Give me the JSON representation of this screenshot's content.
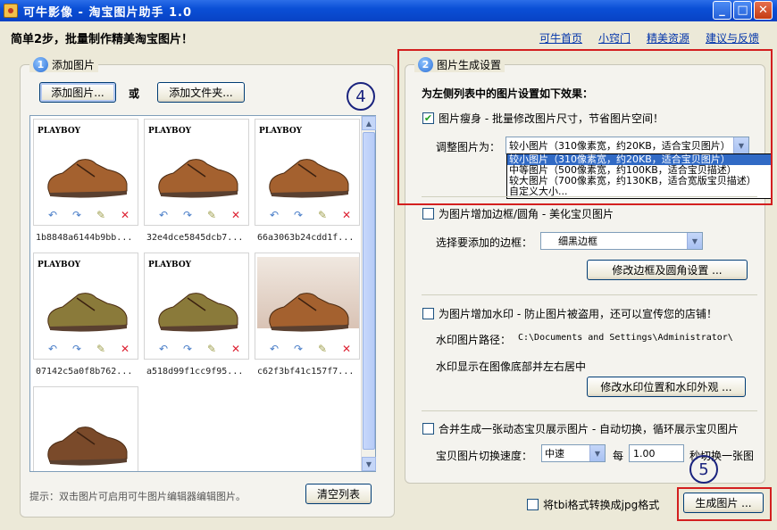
{
  "window": {
    "title": "可牛影像 - 淘宝图片助手 1.0",
    "min": "_",
    "max": "□",
    "close": "✕"
  },
  "heading": "简单2步，批量制作精美淘宝图片！",
  "links": [
    "可牛首页",
    "小窍门",
    "精美资源",
    "建议与反馈"
  ],
  "left": {
    "step_num": "1",
    "title": "添加图片",
    "add_image_btn": "添加图片...",
    "or": "或",
    "add_folder_btn": "添加文件夹...",
    "hint": "提示：双击图片可启用可牛图片编辑器编辑图片。",
    "clear_btn": "清空列表",
    "thumbs": [
      {
        "logo": "PLAYBOY",
        "name": "1b8848a6144b9bb..."
      },
      {
        "logo": "PLAYBOY",
        "name": "32e4dce5845dcb7..."
      },
      {
        "logo": "PLAYBOY",
        "name": "66a3063b24cdd1f..."
      },
      {
        "logo": "PLAYBOY",
        "name": "07142c5a0f8b762..."
      },
      {
        "logo": "PLAYBOY",
        "name": "a518d99f1cc9f95..."
      },
      {
        "logo": "",
        "name": "c62f3bf41c157f7..."
      },
      {
        "logo": "",
        "name": ""
      }
    ],
    "tool_icons": [
      "undo-icon",
      "redo-icon",
      "edit-icon",
      "delete-icon"
    ]
  },
  "right": {
    "step_num": "2",
    "title": "图片生成设置",
    "subtitle": "为左侧列表中的图片设置如下效果：",
    "resize": {
      "checked": true,
      "label": "图片瘦身 - 批量修改图片尺寸，节省图片空间！",
      "adjust_label": "调整图片为：",
      "selected": "较小图片（310像素宽，约20KB，适合宝贝图片）",
      "options": [
        "较小图片（310像素宽，约20KB，适合宝贝图片）",
        "中等图片（500像素宽，约100KB，适合宝贝描述）",
        "较大图片（700像素宽，约130KB，适合宽版宝贝描述）",
        "自定义大小..."
      ]
    },
    "border": {
      "checked": false,
      "label": "为图片增加边框/圆角 - 美化宝贝图片",
      "select_label": "选择要添加的边框：",
      "selected": "细黑边框",
      "modify_btn": "修改边框及圆角设置 ..."
    },
    "watermark": {
      "checked": false,
      "label": "为图片增加水印 - 防止图片被盗用，还可以宣传您的店铺！",
      "path_label": "水印图片路径：",
      "path": "C:\\Documents and Settings\\Administrator\\",
      "position_text": "水印显示在图像底部并左右居中",
      "modify_btn": "修改水印位置和水印外观 ..."
    },
    "merge": {
      "checked": false,
      "label": "合并生成一张动态宝贝展示图片 - 自动切换，循环展示宝贝图片",
      "speed_label": "宝贝图片切换速度：",
      "speed": "中速",
      "every": "每",
      "interval": "1.00",
      "interval_suffix": "秒切换一张图"
    },
    "convert_tbi": {
      "checked": false,
      "label": "将tbi格式转换成jpg格式"
    },
    "generate_btn": "生成图片 ..."
  },
  "annotations": {
    "num4": "4",
    "num5": "5"
  },
  "colors": {
    "highlight_red": "#d31f1f",
    "selection_blue": "#316ac5"
  }
}
